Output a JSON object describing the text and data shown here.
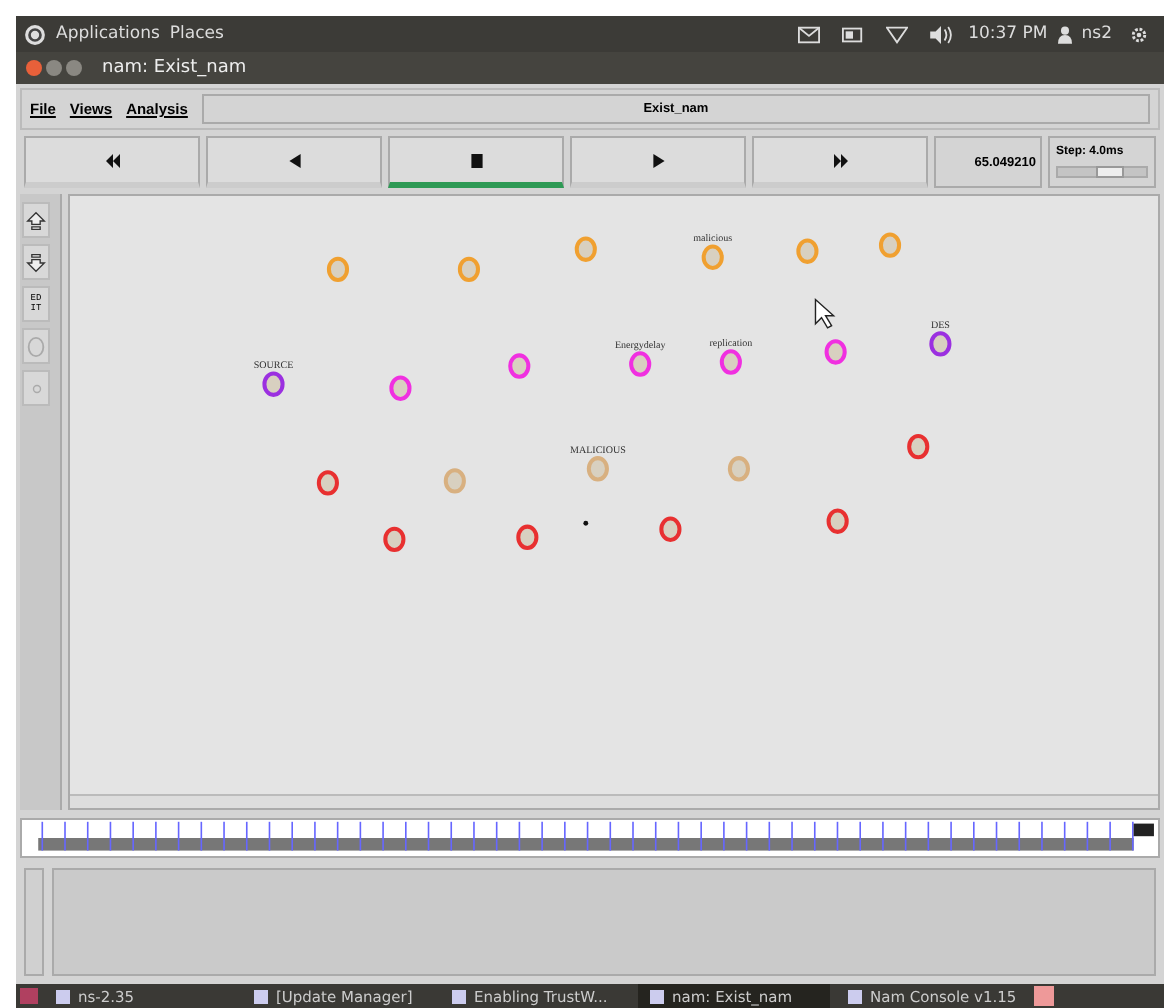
{
  "top_panel": {
    "menus": [
      "Applications",
      "Places"
    ],
    "clock": "10:37 PM",
    "user": "ns2"
  },
  "window": {
    "title": "nam: Exist_nam"
  },
  "menu_bar": {
    "items": [
      "File",
      "Views",
      "Analysis"
    ],
    "file_name": "Exist_nam"
  },
  "controls": {
    "buttons": [
      {
        "kind": "fast-rewind",
        "selected": false
      },
      {
        "kind": "rewind",
        "selected": false
      },
      {
        "kind": "stop",
        "selected": true
      },
      {
        "kind": "play",
        "selected": false
      },
      {
        "kind": "fast-forward",
        "selected": false
      }
    ],
    "time": "65.049210",
    "step": {
      "label": "Step: 4.0ms",
      "level": 0.6
    }
  },
  "side_tools": [
    {
      "kind": "zoom-in"
    },
    {
      "kind": "zoom-out"
    },
    {
      "kind": "edit",
      "label": "ED IT"
    },
    {
      "kind": "ring"
    },
    {
      "kind": "dot"
    }
  ],
  "nodes": [
    {
      "color": "#f0a030"
    },
    {
      "color": "#f0a030"
    },
    {
      "color": "#f0a030"
    },
    {
      "color": "#f0a030",
      "label": "malicious"
    },
    {
      "color": "#f0a030"
    },
    {
      "color": "#f0a030"
    },
    {
      "color": "#9b30e0",
      "label": "SOURCE"
    },
    {
      "color": "#f030e0"
    },
    {
      "color": "#f030e0"
    },
    {
      "color": "#f030e0",
      "label": "Energydelay"
    },
    {
      "color": "#f030e0",
      "label": "replication"
    },
    {
      "color": "#f030e0"
    },
    {
      "color": "#9b30e0",
      "label": "DES"
    },
    {
      "color": "#e83030"
    },
    {
      "color": "#d8b080"
    },
    {
      "color": "#d8b080",
      "label": "MALICIOUS"
    },
    {
      "color": "#d8b080"
    },
    {
      "color": "#e83030"
    },
    {
      "color": "#e83030"
    },
    {
      "color": "#e83030"
    },
    {
      "color": "#e83030"
    },
    {
      "color": "#e83030"
    }
  ],
  "taskbar": [
    {
      "label": "ns-2.35",
      "selected": false
    },
    {
      "label": "[Update Manager]",
      "selected": false
    },
    {
      "label": "Enabling TrustW...",
      "selected": false
    },
    {
      "label": "nam: Exist_nam",
      "selected": true
    },
    {
      "label": "Nam Console v1.15",
      "selected": false
    }
  ]
}
